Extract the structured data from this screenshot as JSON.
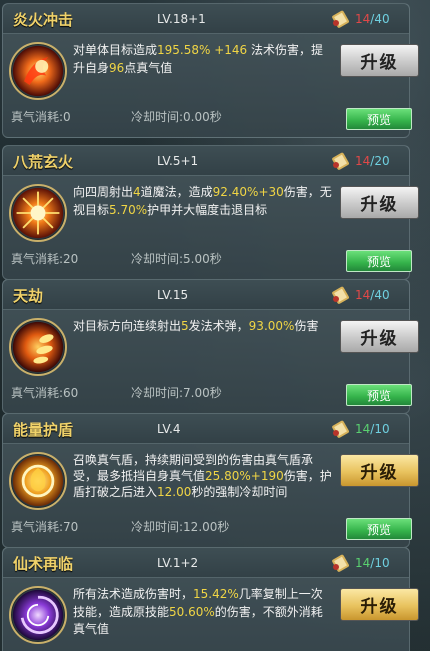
{
  "skills": [
    {
      "name": "炎火冲击",
      "level": "LV.18+1",
      "count_cur": "14",
      "count_max": "/40",
      "count_state": "red",
      "desc": [
        {
          "t": "对单体目标造成",
          "s": ""
        },
        {
          "t": "195.58%",
          "s": "y"
        },
        {
          "t": " +146",
          "s": "y"
        },
        {
          "t": " 法术伤害，提升自身",
          "s": ""
        },
        {
          "t": "96",
          "s": "y"
        },
        {
          "t": "点真气值",
          "s": ""
        }
      ],
      "cost": "真气消耗:0",
      "cooldown": "冷却时间:0.00秒",
      "upgrade_label": "升级",
      "upgrade_style": "gray",
      "preview_label": "预览",
      "icon": "fire-burst-icon"
    },
    {
      "name": "八荒玄火",
      "level": "LV.5+1",
      "count_cur": "14",
      "count_max": "/20",
      "count_state": "red",
      "desc": [
        {
          "t": "向四周射出",
          "s": ""
        },
        {
          "t": "4",
          "s": "y"
        },
        {
          "t": "道魔法，造成",
          "s": ""
        },
        {
          "t": "92.40%",
          "s": "y"
        },
        {
          "t": "+30",
          "s": "y"
        },
        {
          "t": "伤害，无视目标",
          "s": ""
        },
        {
          "t": "5.70%",
          "s": "y"
        },
        {
          "t": "护甲并大幅度击退目标",
          "s": ""
        }
      ],
      "cost": "真气消耗:20",
      "cooldown": "冷却时间:5.00秒",
      "upgrade_label": "升级",
      "upgrade_style": "gray",
      "preview_label": "预览",
      "icon": "fire-nova-icon"
    },
    {
      "name": "天劫",
      "level": "LV.15",
      "count_cur": "14",
      "count_max": "/40",
      "count_state": "red",
      "desc": [
        {
          "t": "对目标方向连续射出",
          "s": ""
        },
        {
          "t": "5",
          "s": "y"
        },
        {
          "t": "发法术弹，",
          "s": ""
        },
        {
          "t": "93.00%",
          "s": "y"
        },
        {
          "t": "伤害",
          "s": ""
        }
      ],
      "cost": "真气消耗:60",
      "cooldown": "冷却时间:7.00秒",
      "upgrade_label": "升级",
      "upgrade_style": "gray",
      "preview_label": "预览",
      "icon": "fireball-volley-icon"
    },
    {
      "name": "能量护盾",
      "level": "LV.4",
      "count_cur": "14",
      "count_max": "/10",
      "count_state": "grn",
      "desc": [
        {
          "t": "召唤真气盾，持续期间受到的伤害由真气盾承受，最多抵挡自身真气值",
          "s": ""
        },
        {
          "t": "25.80%",
          "s": "y"
        },
        {
          "t": "+190",
          "s": "y"
        },
        {
          "t": "伤害，护盾打破之后进入",
          "s": ""
        },
        {
          "t": "12.00",
          "s": "y"
        },
        {
          "t": "秒的强制冷却时间",
          "s": ""
        }
      ],
      "cost": "真气消耗:70",
      "cooldown": "冷却时间:12.00秒",
      "upgrade_label": "升级",
      "upgrade_style": "gold",
      "preview_label": "预览",
      "icon": "energy-shield-icon"
    },
    {
      "name": "仙术再临",
      "level": "LV.1+2",
      "count_cur": "14",
      "count_max": "/10",
      "count_state": "grn",
      "desc": [
        {
          "t": "所有法术造成伤害时，",
          "s": ""
        },
        {
          "t": "15.42%",
          "s": "y"
        },
        {
          "t": "几率复制上一次技能，造成原技能",
          "s": ""
        },
        {
          "t": "50.60%",
          "s": "y"
        },
        {
          "t": "的伤害，不额外消耗真气值",
          "s": ""
        }
      ],
      "cost": "",
      "cooldown": "",
      "upgrade_label": "升级",
      "upgrade_style": "gold",
      "preview_label": "",
      "icon": "arcane-vortex-icon"
    }
  ]
}
